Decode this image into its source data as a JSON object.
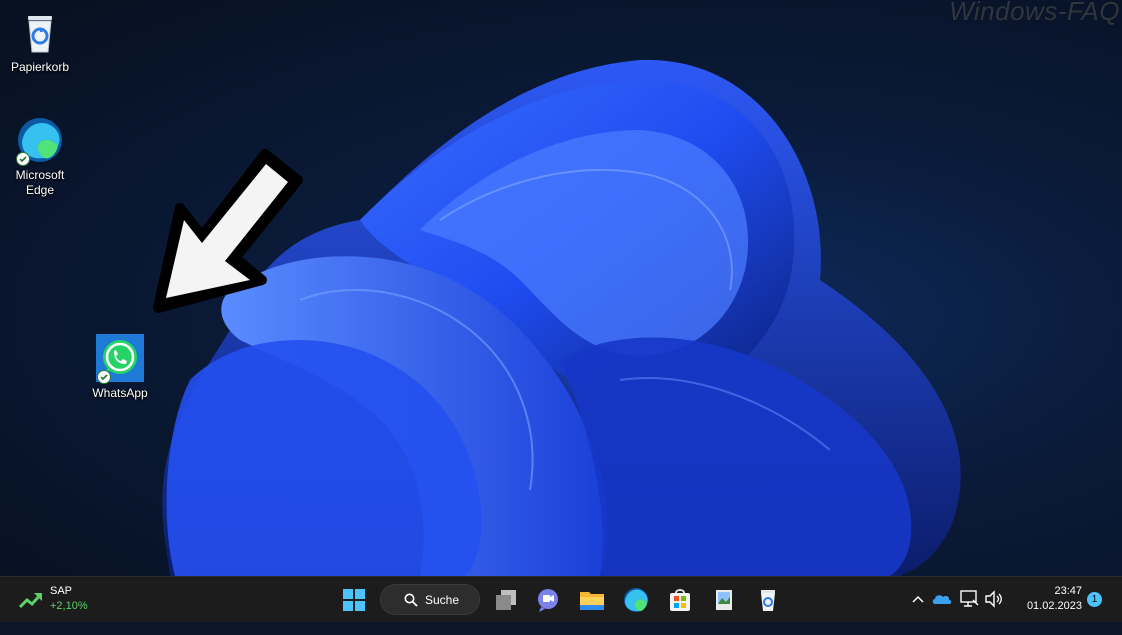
{
  "watermark": "Windows-FAQ",
  "desktop_icons": [
    {
      "label": "Papierkorb",
      "icon": "recycle-bin-icon"
    },
    {
      "label": "Microsoft Edge",
      "icon": "edge-icon"
    },
    {
      "label": "WhatsApp",
      "icon": "whatsapp-icon"
    }
  ],
  "taskbar": {
    "widget": {
      "name": "SAP",
      "change": "+2,10%"
    },
    "search_label": "Suche",
    "apps": [
      "start-icon",
      "task-view-icon",
      "teams-chat-icon",
      "file-explorer-icon",
      "edge-icon",
      "store-icon",
      "photo-viewer-icon",
      "recycle-bin-icon"
    ],
    "tray": {
      "time": "23:47",
      "date": "01.02.2023",
      "notifications": "1"
    }
  },
  "colors": {
    "taskbar_bg": "#1c1c1c",
    "stock_green": "#5fd068",
    "whatsapp_green": "#25d366",
    "accent": "#4cc2ff"
  }
}
